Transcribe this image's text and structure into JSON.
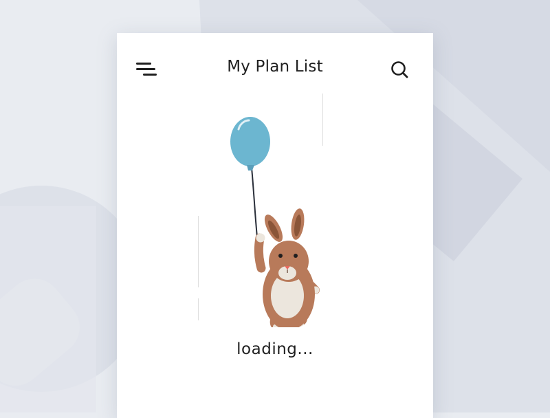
{
  "header": {
    "title": "My Plan List",
    "menu_icon": "menu-icon",
    "search_icon": "search-icon"
  },
  "main": {
    "status_text": "loading...",
    "illustration": "bunny-with-balloon"
  },
  "colors": {
    "background": "#e9ecf1",
    "card": "#ffffff",
    "text": "#1f1f1f",
    "balloon": "#6cb6d0",
    "bunny_fur": "#b87a5a",
    "bunny_belly": "#ece6dd"
  }
}
